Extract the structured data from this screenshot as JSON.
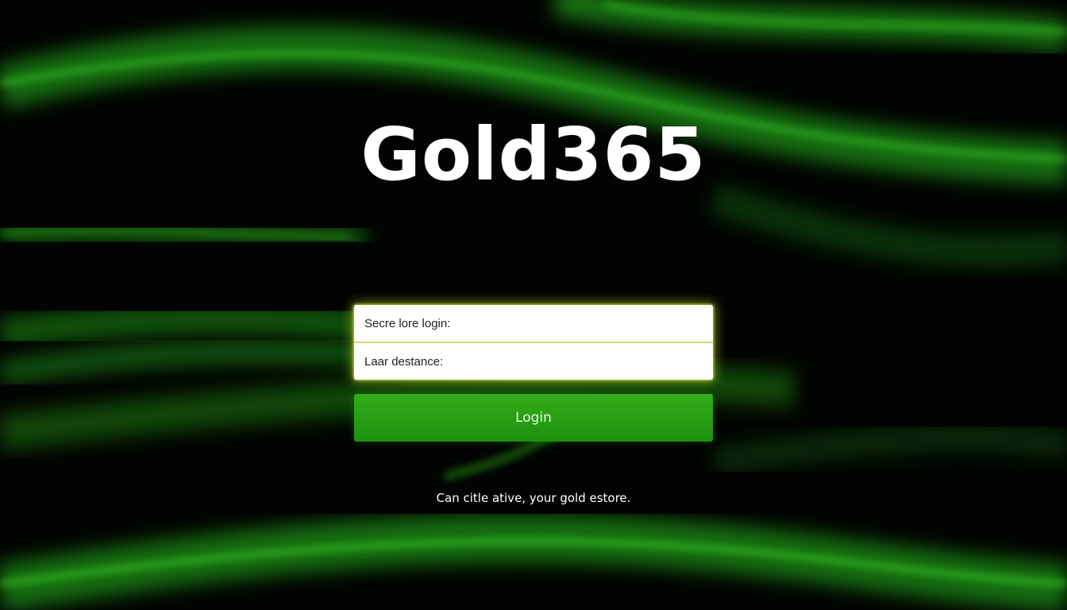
{
  "brand": {
    "name": "Gold365"
  },
  "form": {
    "username_placeholder": "Secre lore login:",
    "password_placeholder": "Laar destance:",
    "login_label": "Login"
  },
  "footer": {
    "tagline": "Can citle ative, your gold estore."
  },
  "theme": {
    "background": "#020402",
    "accent_green": "#2aa317",
    "glow_yellow": "#c8e628",
    "text_white": "#ffffff"
  }
}
